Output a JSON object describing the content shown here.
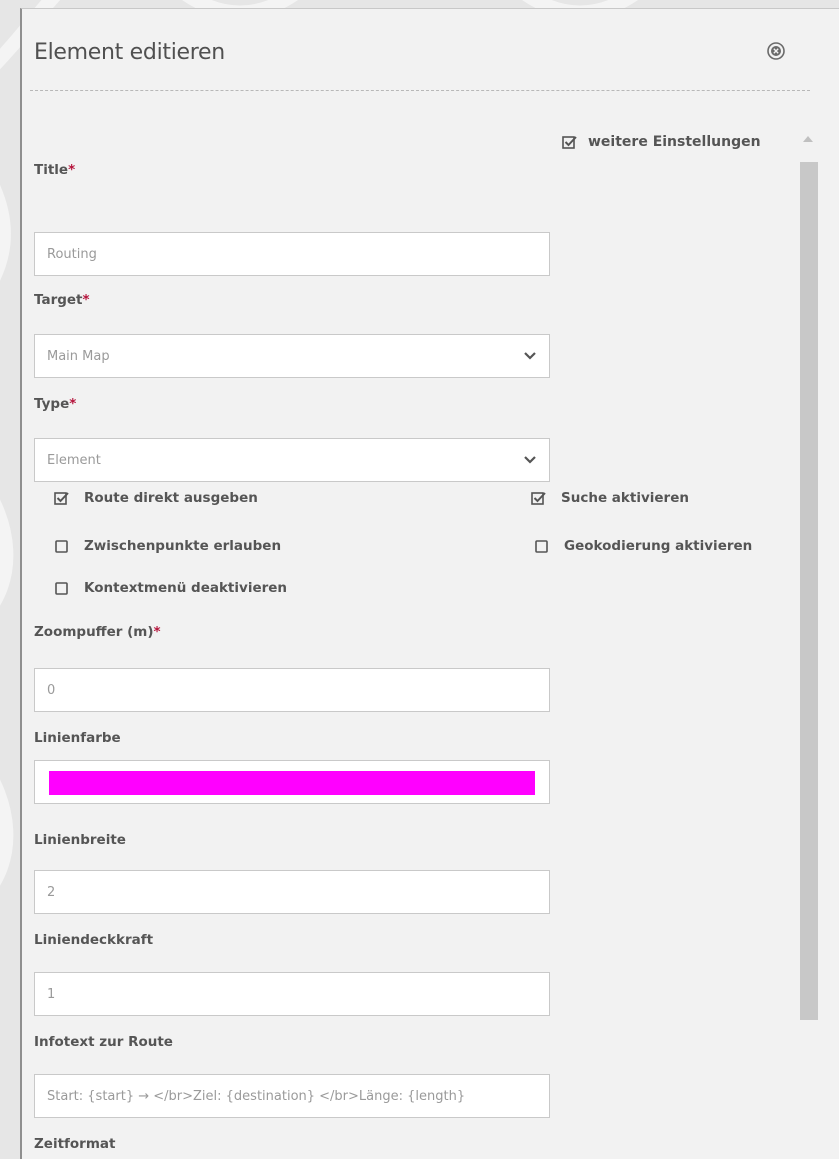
{
  "dialog": {
    "title": "Element editieren",
    "more_settings_label": "weitere Einstellungen",
    "more_settings_checked": true
  },
  "fields": {
    "title": {
      "label": "Title",
      "required_mark": "*",
      "value": "Routing"
    },
    "target": {
      "label": "Target",
      "required_mark": "*",
      "value": "Main Map"
    },
    "type": {
      "label": "Type",
      "required_mark": "*",
      "value": "Element"
    },
    "zoom_buffer": {
      "label": "Zoompuffer (m)",
      "required_mark": "*",
      "value": "0"
    },
    "line_color": {
      "label": "Linienfarbe",
      "value": "#ff00ff"
    },
    "line_width": {
      "label": "Linienbreite",
      "value": "2"
    },
    "line_opacity": {
      "label": "Liniendeckkraft",
      "value": "1"
    },
    "info_text": {
      "label": "Infotext zur Route",
      "value": "Start: {start} → </br>Ziel: {destination} </br>Länge: {length}"
    },
    "time_format": {
      "label": "Zeitformat"
    }
  },
  "checkboxes": {
    "route_direct": {
      "label": "Route direkt ausgeben",
      "checked": true
    },
    "search_active": {
      "label": "Suche aktivieren",
      "checked": true
    },
    "waypoints": {
      "label": "Zwischenpunkte erlauben",
      "checked": false
    },
    "geocoding": {
      "label": "Geokodierung aktivieren",
      "checked": false
    },
    "context_menu": {
      "label": "Kontextmenü deaktivieren",
      "checked": false
    }
  },
  "icons": {
    "close": "close-circle-icon",
    "select_arrow": "chevron-down-icon",
    "checkbox_checked": "checkbox-checked-icon",
    "checkbox_empty": "checkbox-empty-icon"
  },
  "colors": {
    "required": "#b5143c",
    "line_color_swatch": "#ff00ff"
  }
}
